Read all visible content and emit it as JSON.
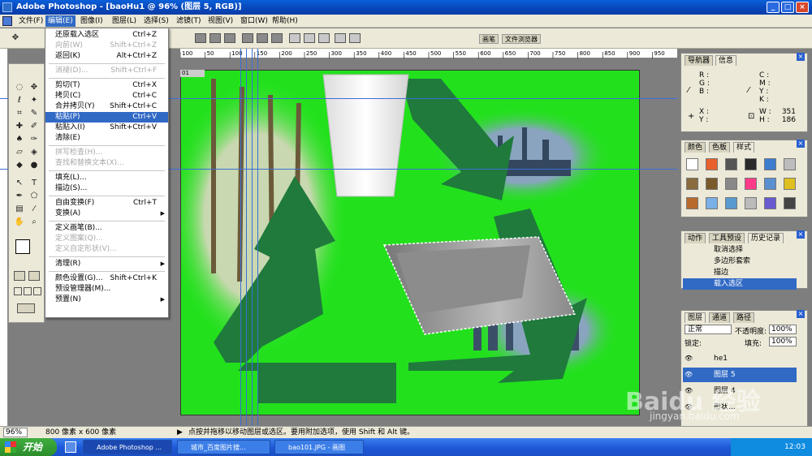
{
  "window": {
    "title": "Adobe Photoshop - [baoHu1 @ 96% (图层 5, RGB)]"
  },
  "menubar": [
    "文件(F)",
    "编辑(E)",
    "图像(I)",
    "图层(L)",
    "选择(S)",
    "滤镜(T)",
    "视图(V)",
    "窗口(W)",
    "帮助(H)"
  ],
  "optbar": {
    "tabs": [
      "画笔",
      "文件浏览器"
    ]
  },
  "ruler_ticks": [
    "100",
    "50",
    "100",
    "150",
    "200",
    "250",
    "300",
    "350",
    "400",
    "450",
    "500",
    "550",
    "600",
    "650",
    "700",
    "750",
    "800",
    "850",
    "900",
    "950"
  ],
  "document": {
    "tab": "01"
  },
  "edit_menu": {
    "items": [
      {
        "label": "还原载入选区",
        "shortcut": "Ctrl+Z",
        "state": "enabled"
      },
      {
        "label": "向前(W)",
        "shortcut": "Shift+Ctrl+Z",
        "state": "disabled"
      },
      {
        "label": "返回(K)",
        "shortcut": "Alt+Ctrl+Z",
        "state": "enabled"
      },
      {
        "sep": true
      },
      {
        "label": "消褪(D)...",
        "shortcut": "Shift+Ctrl+F",
        "state": "disabled"
      },
      {
        "sep": true
      },
      {
        "label": "剪切(T)",
        "shortcut": "Ctrl+X",
        "state": "enabled"
      },
      {
        "label": "拷贝(C)",
        "shortcut": "Ctrl+C",
        "state": "enabled"
      },
      {
        "label": "合并拷贝(Y)",
        "shortcut": "Shift+Ctrl+C",
        "state": "enabled"
      },
      {
        "label": "粘贴(P)",
        "shortcut": "Ctrl+V",
        "state": "highlighted"
      },
      {
        "label": "粘贴入(I)",
        "shortcut": "Shift+Ctrl+V",
        "state": "enabled"
      },
      {
        "label": "清除(E)",
        "shortcut": "",
        "state": "enabled"
      },
      {
        "sep": true
      },
      {
        "label": "拼写检查(H)...",
        "shortcut": "",
        "state": "disabled"
      },
      {
        "label": "查找和替换文本(X)...",
        "shortcut": "",
        "state": "disabled"
      },
      {
        "sep": true
      },
      {
        "label": "填充(L)...",
        "shortcut": "",
        "state": "enabled"
      },
      {
        "label": "描边(S)...",
        "shortcut": "",
        "state": "enabled"
      },
      {
        "sep": true
      },
      {
        "label": "自由变换(F)",
        "shortcut": "Ctrl+T",
        "state": "enabled"
      },
      {
        "label": "变换(A)",
        "shortcut": "",
        "state": "enabled",
        "submenu": true
      },
      {
        "sep": true
      },
      {
        "label": "定义画笔(B)...",
        "shortcut": "",
        "state": "enabled"
      },
      {
        "label": "定义图案(Q)...",
        "shortcut": "",
        "state": "disabled"
      },
      {
        "label": "定义自定形状(V)...",
        "shortcut": "",
        "state": "disabled"
      },
      {
        "sep": true
      },
      {
        "label": "清理(R)",
        "shortcut": "",
        "state": "enabled",
        "submenu": true
      },
      {
        "sep": true
      },
      {
        "label": "颜色设置(G)...",
        "shortcut": "Shift+Ctrl+K",
        "state": "enabled"
      },
      {
        "label": "预设管理器(M)...",
        "shortcut": "",
        "state": "enabled"
      },
      {
        "label": "预置(N)",
        "shortcut": "",
        "state": "enabled",
        "submenu": true
      }
    ]
  },
  "navigator_panel": {
    "tabs": [
      "导航器",
      "信息"
    ],
    "rgb_labels": [
      "R :",
      "G :",
      "B :"
    ],
    "cmyk_labels": [
      "C :",
      "M :",
      "Y :",
      "K :"
    ],
    "xy_labels": [
      "X :",
      "Y :"
    ],
    "wh": {
      "w_label": "W :",
      "w_value": "351",
      "h_label": "H :",
      "h_value": "186"
    }
  },
  "swatches_panel": {
    "tabs": [
      "颜色",
      "色板",
      "样式"
    ]
  },
  "history_panel": {
    "tabs": [
      "动作",
      "工具预设",
      "历史记录"
    ],
    "items": [
      "取消选择",
      "多边形套索",
      "描边",
      "载入选区"
    ],
    "selected_index": 3
  },
  "layers_panel": {
    "tabs": [
      "图层",
      "通道",
      "路径"
    ],
    "blend_mode": "正常",
    "opacity_label": "不透明度:",
    "opacity_value": "100%",
    "lock_label": "锁定:",
    "fill_label": "填充:",
    "fill_value": "100%",
    "layers": [
      "he1",
      "图层 5",
      "图层 4",
      "形状..."
    ]
  },
  "statusbar": {
    "zoom": "96%",
    "doc_size": "800 像素 x 600 像素",
    "hint": "点按并拖移以移动图层或选区。要用附加选项，使用 Shift 和 Alt 键。"
  },
  "taskbar": {
    "start": "开始",
    "tasks": [
      "Adobe Photoshop ...",
      "城市_百度图片搜...",
      "bao101.JPG - 画图"
    ],
    "clock": "12:03"
  },
  "watermark": {
    "text": "Baidu 经验",
    "url": "jingyan.baidu.com"
  },
  "colors": {
    "canvas_green": "#22e11c",
    "arrow_green": "#1f7a3c",
    "xp_blue": "#0a5fd8",
    "highlight": "#316ac5"
  }
}
